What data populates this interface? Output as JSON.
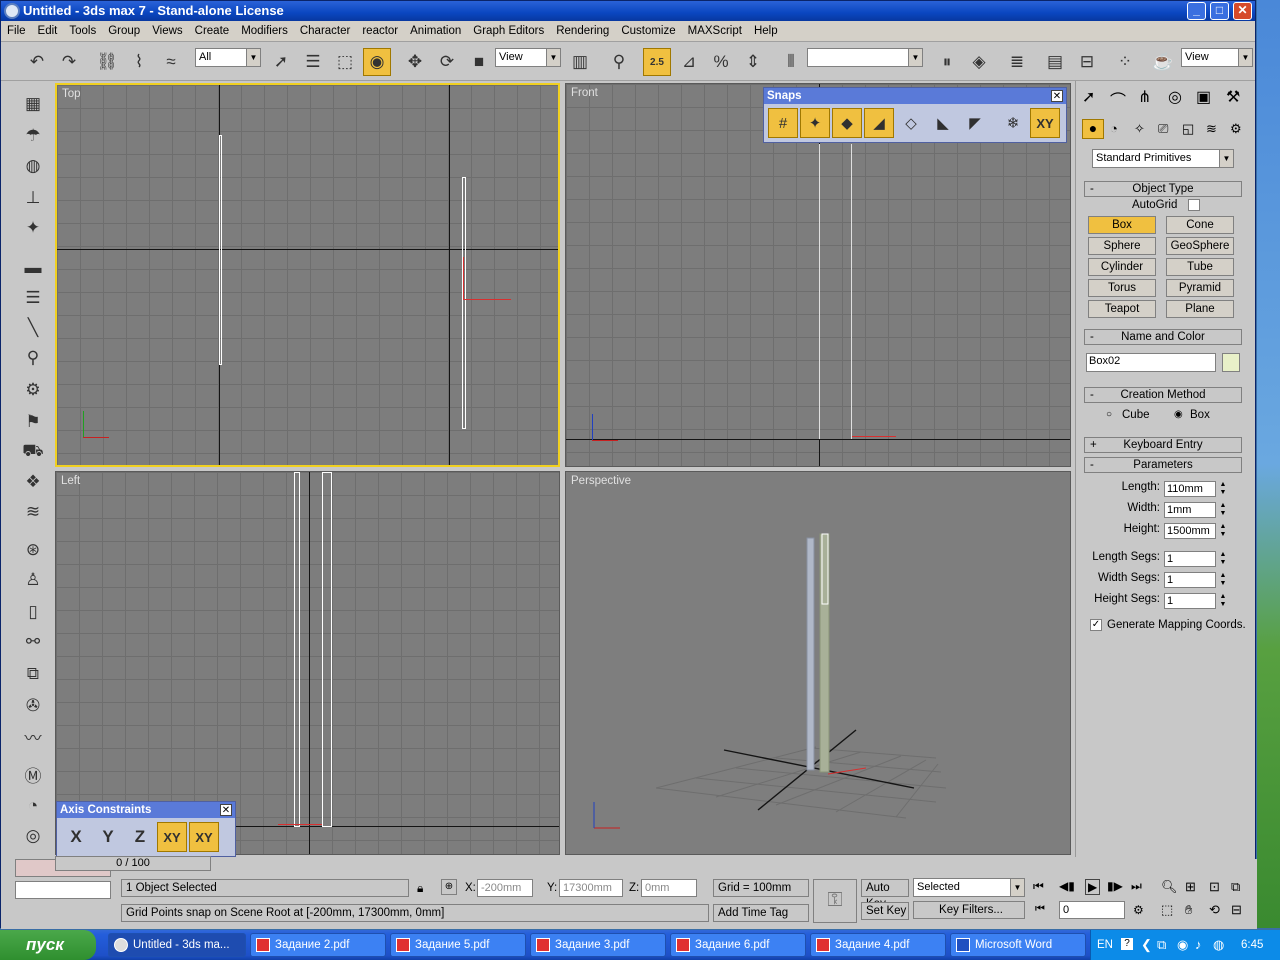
{
  "window": {
    "title": "Untitled - 3ds max 7  - Stand-alone License"
  },
  "menu": [
    "File",
    "Edit",
    "Tools",
    "Group",
    "Views",
    "Create",
    "Modifiers",
    "Character",
    "reactor",
    "Animation",
    "Graph Editors",
    "Rendering",
    "Customize",
    "MAXScript",
    "Help"
  ],
  "toolbar": {
    "selection_filter": "All",
    "ref_coord": "View",
    "ref_coord2": "View",
    "snap_value": "2.5"
  },
  "viewports": {
    "top": "Top",
    "front": "Front",
    "left": "Left",
    "perspective": "Perspective"
  },
  "snaps": {
    "title": "Snaps",
    "xy": "XY"
  },
  "axis_constraints": {
    "title": "Axis Constraints",
    "x": "X",
    "y": "Y",
    "z": "Z",
    "xy": "XY",
    "xy2": "XY"
  },
  "command_panel": {
    "category": "Standard Primitives",
    "object_type": "Object Type",
    "autogrid": "AutoGrid",
    "buttons": [
      "Box",
      "Cone",
      "Sphere",
      "GeoSphere",
      "Cylinder",
      "Tube",
      "Torus",
      "Pyramid",
      "Teapot",
      "Plane"
    ],
    "name_color": "Name and Color",
    "object_name": "Box02",
    "object_color": "#e8f0c8",
    "creation_method": "Creation Method",
    "cube": "Cube",
    "box": "Box",
    "keyboard_entry": "Keyboard Entry",
    "parameters": "Parameters",
    "length_label": "Length:",
    "length": "110mm",
    "width_label": "Width:",
    "width": "1mm",
    "height_label": "Height:",
    "height": "1500mm",
    "length_segs_label": "Length Segs:",
    "length_segs": "1",
    "width_segs_label": "Width Segs:",
    "width_segs": "1",
    "height_segs_label": "Height Segs:",
    "height_segs": "1",
    "gen_mapping": "Generate Mapping Coords."
  },
  "status": {
    "time_slider": "0 / 100",
    "selected": "1 Object Selected",
    "prompt": "Grid Points snap on Scene Root at [-200mm, 17300mm, 0mm]",
    "x_label": "X:",
    "x": "-200mm",
    "y_label": "Y:",
    "y": "17300mm",
    "z_label": "Z:",
    "z": "0mm",
    "grid": "Grid = 100mm",
    "add_time_tag": "Add Time Tag",
    "auto_key": "Auto Key",
    "set_key": "Set Key",
    "key_mode": "Selected",
    "key_filters": "Key Filters...",
    "frame": "0"
  },
  "taskbar": {
    "start": "пуск",
    "tasks": [
      "Untitled - 3ds ma...",
      "Задание 2.pdf",
      "Задание 5.pdf",
      "Задание 3.pdf",
      "Задание 6.pdf",
      "Задание 4.pdf",
      "Microsoft Word"
    ],
    "lang": "EN",
    "clock": "6:45"
  }
}
